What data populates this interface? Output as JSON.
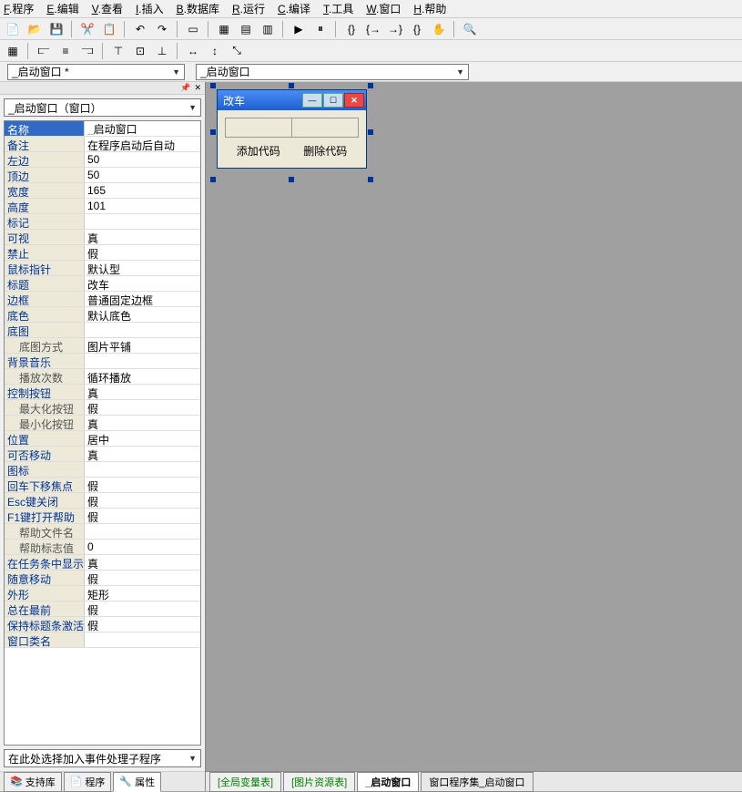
{
  "menu": [
    "F.程序",
    "E.编辑",
    "V.查看",
    "I.插入",
    "B.数据库",
    "R.运行",
    "C.编译",
    "T.工具",
    "W.窗口",
    "H.帮助"
  ],
  "combo1": "_启动窗口 *",
  "combo2": "_启动窗口",
  "type_combo": "_启动窗口（窗口）",
  "props": [
    {
      "label": "名称",
      "value": "_启动窗口",
      "selected": true,
      "edit": true
    },
    {
      "label": "备注",
      "value": "在程序启动后自动"
    },
    {
      "label": "左边",
      "value": "50"
    },
    {
      "label": "顶边",
      "value": "50"
    },
    {
      "label": "宽度",
      "value": "165"
    },
    {
      "label": "高度",
      "value": "101"
    },
    {
      "label": "标记",
      "value": ""
    },
    {
      "label": "可视",
      "value": "真"
    },
    {
      "label": "禁止",
      "value": "假"
    },
    {
      "label": "鼠标指针",
      "value": "默认型"
    },
    {
      "label": "标题",
      "value": "改车"
    },
    {
      "label": "边框",
      "value": "普通固定边框"
    },
    {
      "label": "底色",
      "value": "默认底色"
    },
    {
      "label": "底图",
      "value": ""
    },
    {
      "label": "底图方式",
      "value": "图片平铺",
      "indent": true
    },
    {
      "label": "背景音乐",
      "value": ""
    },
    {
      "label": "播放次数",
      "value": "循环播放",
      "indent": true
    },
    {
      "label": "控制按钮",
      "value": "真"
    },
    {
      "label": "最大化按钮",
      "value": "假",
      "indent": true
    },
    {
      "label": "最小化按钮",
      "value": "真",
      "indent": true
    },
    {
      "label": "位置",
      "value": "居中"
    },
    {
      "label": "可否移动",
      "value": "真"
    },
    {
      "label": "图标",
      "value": ""
    },
    {
      "label": "回车下移焦点",
      "value": "假"
    },
    {
      "label": "Esc键关闭",
      "value": "假"
    },
    {
      "label": "F1键打开帮助",
      "value": "假"
    },
    {
      "label": "帮助文件名",
      "value": "",
      "indent": true
    },
    {
      "label": "帮助标志值",
      "value": "0",
      "indent": true
    },
    {
      "label": "在任务条中显示",
      "value": "真"
    },
    {
      "label": "随意移动",
      "value": "假"
    },
    {
      "label": "外形",
      "value": "矩形"
    },
    {
      "label": "总在最前",
      "value": "假"
    },
    {
      "label": "保持标题条激活",
      "value": "假"
    },
    {
      "label": "窗口类名",
      "value": ""
    }
  ],
  "event_combo": "在此处选择加入事件处理子程序",
  "left_tabs": [
    {
      "icon": "📚",
      "label": "支持库"
    },
    {
      "icon": "📄",
      "label": "程序"
    },
    {
      "icon": "🔧",
      "label": "属性",
      "active": true
    }
  ],
  "form": {
    "title": "改车",
    "btn1": "添加代码",
    "btn2": "删除代码"
  },
  "design_tabs": [
    {
      "label": "[全局变量表]",
      "cls": "green"
    },
    {
      "label": "[图片资源表]",
      "cls": "green"
    },
    {
      "label": "_启动窗口",
      "cls": "active"
    },
    {
      "label": "窗口程序集_启动窗口",
      "cls": ""
    }
  ]
}
